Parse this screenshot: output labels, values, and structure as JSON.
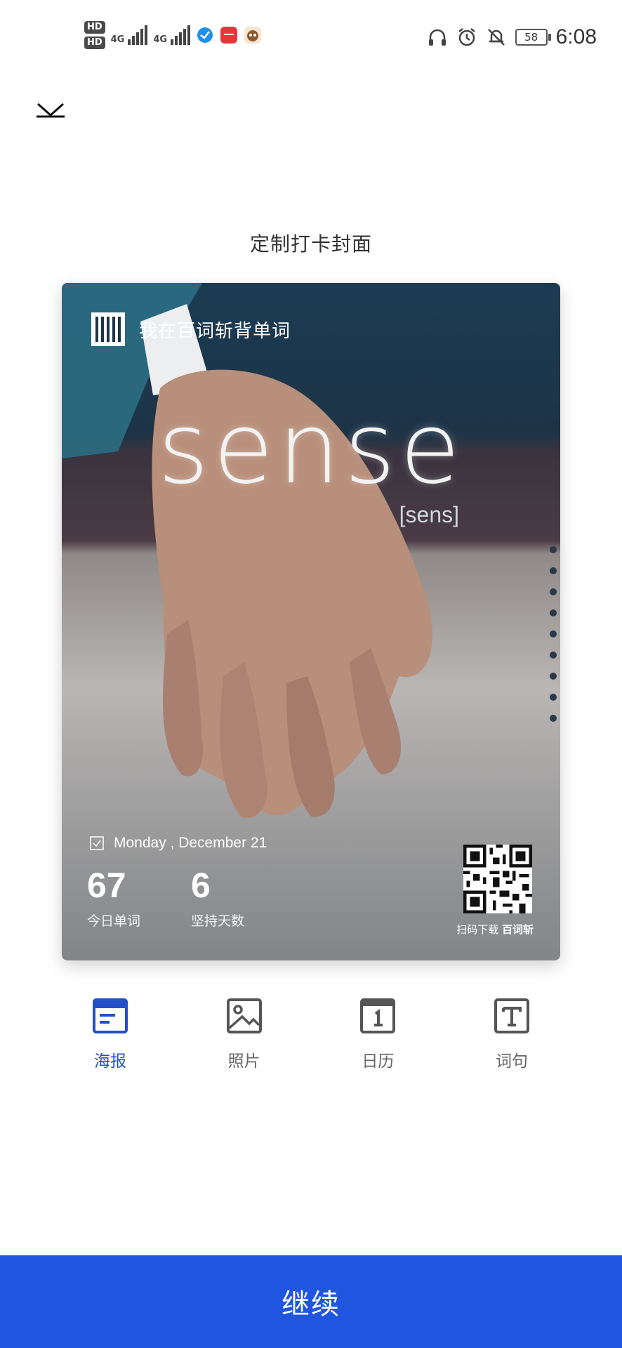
{
  "status_bar": {
    "hd1": "HD",
    "hd2": "HD",
    "net1": "4G",
    "net2": "4G",
    "battery": "58",
    "time": "6:08"
  },
  "page": {
    "title": "定制打卡封面",
    "continue_label": "继续"
  },
  "poster": {
    "tagline": "我在百词斩背单词",
    "word": "sense",
    "phonetic": "[sens]",
    "date": "Monday , December 21",
    "stats": [
      {
        "value": "67",
        "label": "今日单词"
      },
      {
        "value": "6",
        "label": "坚持天数"
      }
    ],
    "qr_caption_prefix": "扫码下载",
    "qr_caption_brand": "百词斩"
  },
  "tabs": [
    {
      "label": "海报",
      "icon": "poster-icon",
      "active": true
    },
    {
      "label": "照片",
      "icon": "photo-icon",
      "active": false
    },
    {
      "label": "日历",
      "icon": "calendar-icon",
      "active": false
    },
    {
      "label": "词句",
      "icon": "text-icon",
      "active": false
    }
  ],
  "colors": {
    "accent": "#1f55df",
    "active_tab": "#2350c8",
    "inactive_tab": "#666666"
  }
}
